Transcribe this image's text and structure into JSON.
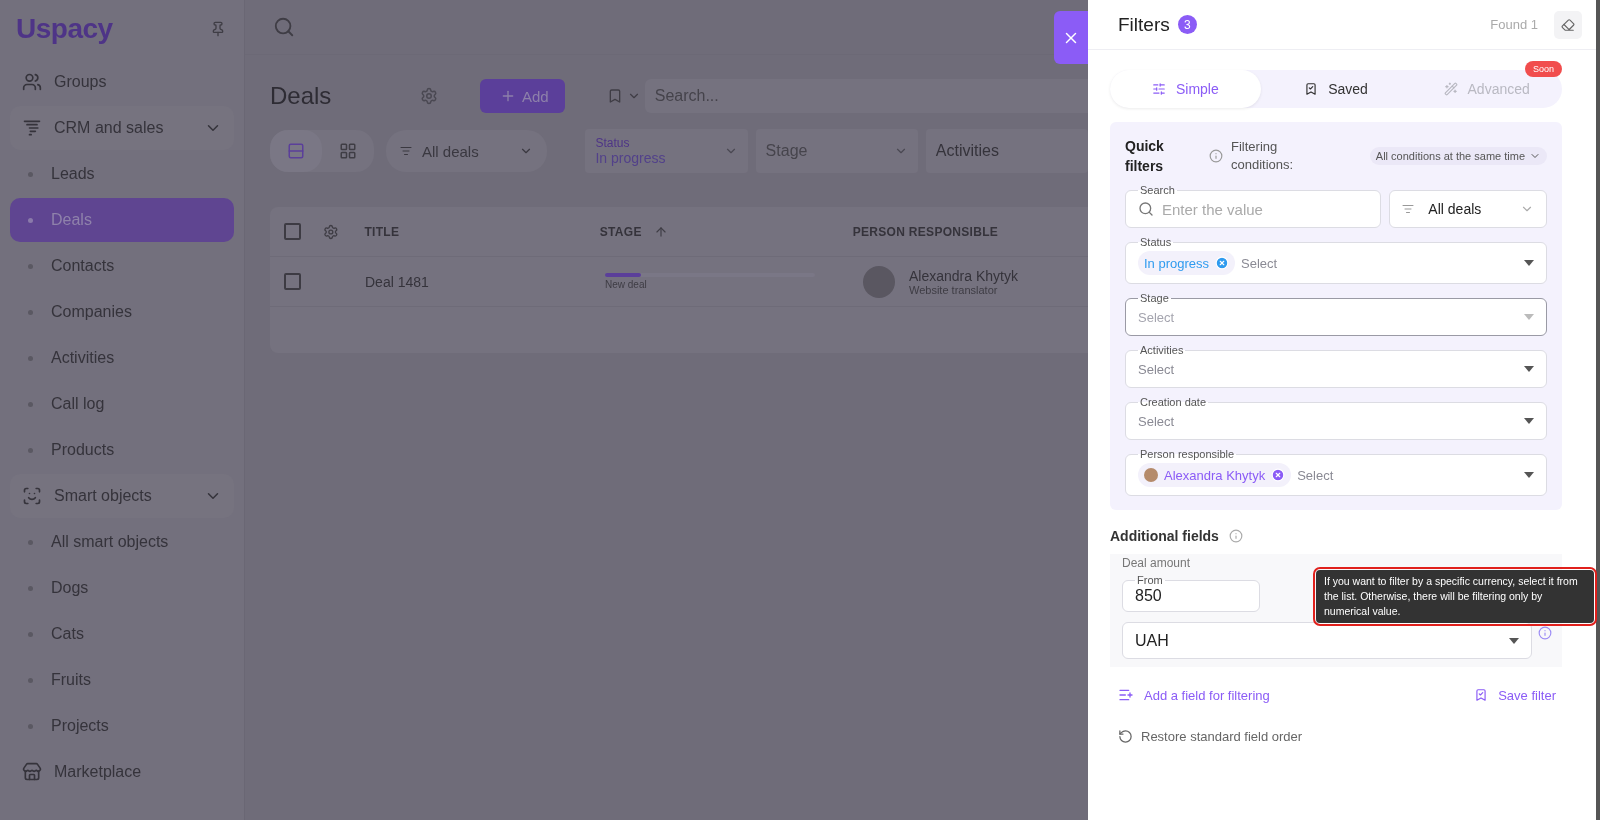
{
  "sidebar": {
    "logo": "Uspacy",
    "items": [
      {
        "kind": "link",
        "label": "Groups",
        "selected": false
      },
      {
        "kind": "group",
        "label": "CRM and sales",
        "expanded": true,
        "children": [
          {
            "label": "Leads",
            "selected": false
          },
          {
            "label": "Deals",
            "selected": true
          },
          {
            "label": "Contacts",
            "selected": false
          },
          {
            "label": "Companies",
            "selected": false
          },
          {
            "label": "Activities",
            "selected": false
          },
          {
            "label": "Call log",
            "selected": false
          },
          {
            "label": "Products",
            "selected": false
          }
        ]
      },
      {
        "kind": "group",
        "label": "Smart objects",
        "expanded": true,
        "children": [
          {
            "label": "All smart objects",
            "selected": false
          },
          {
            "label": "Dogs",
            "selected": false
          },
          {
            "label": "Cats",
            "selected": false
          },
          {
            "label": "Fruits",
            "selected": false
          },
          {
            "label": "Projects",
            "selected": false
          }
        ]
      },
      {
        "kind": "link",
        "label": "Marketplace",
        "selected": false
      }
    ]
  },
  "page": {
    "title": "Deals",
    "add_button": "Add",
    "search": {
      "placeholder": "Search..."
    },
    "views": [
      {
        "kind": "list",
        "selected": true
      },
      {
        "kind": "grid",
        "selected": false
      }
    ],
    "scope": "All deals",
    "filters": [
      {
        "label": "Status",
        "value": "In progress"
      },
      {
        "placeholder": "Stage"
      },
      {
        "value": "Activities"
      }
    ],
    "table": {
      "select_all": {
        "checked": false
      },
      "columns": [
        "TITLE",
        "STAGE",
        "PERSON RESPONSIBLE"
      ],
      "rows": [
        {
          "checked": false,
          "title": "Deal 1481",
          "stage": "New deal",
          "level": 0.17,
          "person": "Alexandra Khytyk",
          "role": "Website translator"
        }
      ]
    }
  },
  "filters_panel": {
    "title": "Filters",
    "count": "3",
    "found": "Found 1",
    "tabs": [
      {
        "kind": "simple",
        "label": "Simple",
        "selected": true,
        "disabled": false
      },
      {
        "kind": "saved",
        "label": "Saved",
        "selected": false,
        "disabled": false
      },
      {
        "kind": "advanced",
        "label": "Advanced",
        "selected": false,
        "disabled": true,
        "badge": "Soon"
      }
    ],
    "quick_filters": {
      "title": "Quick filters",
      "conditions_label": "Filtering conditions:",
      "conditions_value": "All conditions at the same time",
      "search": {
        "label": "Search",
        "placeholder": "Enter the value"
      },
      "scope": "All deals",
      "selects": [
        {
          "label": "Status",
          "placeholder": "Select",
          "focused": false,
          "chips": [
            {
              "kind": "status",
              "label": "In progress"
            }
          ]
        },
        {
          "label": "Stage",
          "placeholder": "Select",
          "focused": true
        },
        {
          "label": "Activities",
          "placeholder": "Select",
          "focused": false
        },
        {
          "label": "Creation date",
          "placeholder": "Select",
          "focused": false
        },
        {
          "label": "Person responsible",
          "placeholder": "Select",
          "focused": false,
          "chips": [
            {
              "kind": "person",
              "label": "Alexandra Khytyk"
            }
          ]
        }
      ]
    },
    "additional": {
      "title": "Additional fields",
      "field_label": "Deal amount",
      "from_label": "From",
      "from_value": "850",
      "currency": "UAH",
      "tooltip": {
        "text": "If you want to filter by a specific currency, select it from the list. Otherwise, there will be filtering only by numerical value.",
        "highlighted": true
      }
    },
    "actions": [
      {
        "kind": "add",
        "label": "Add a field for filtering"
      },
      {
        "kind": "save",
        "label": "Save filter"
      }
    ],
    "restore": "Restore standard field order"
  }
}
